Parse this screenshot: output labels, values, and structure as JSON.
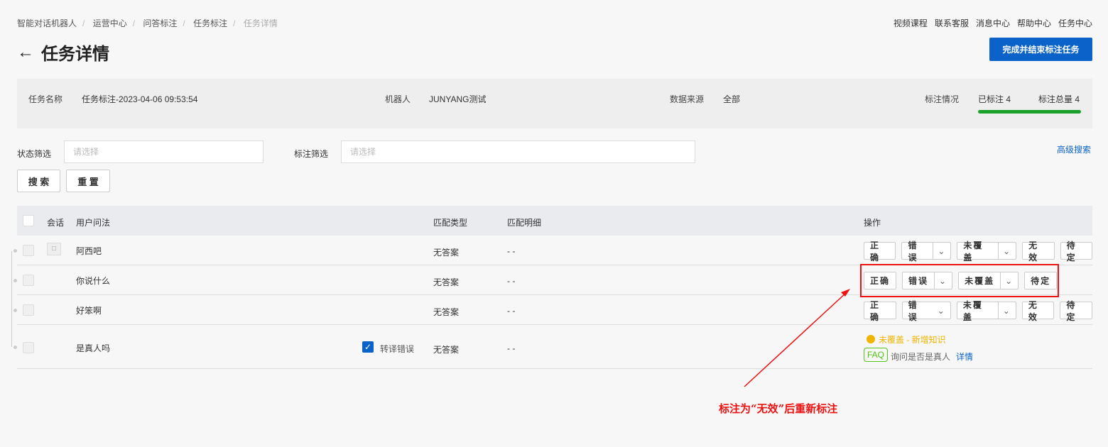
{
  "breadcrumb": [
    "智能对话机器人",
    "运营中心",
    "问答标注",
    "任务标注",
    "任务详情"
  ],
  "top_links": [
    "视频课程",
    "联系客服",
    "消息中心",
    "帮助中心",
    "任务中心"
  ],
  "page_title": "任务详情",
  "finish_button": "完成并结束标注任务",
  "info": {
    "task_name_label": "任务名称",
    "task_name": "任务标注-2023-04-06 09:53:54",
    "robot_label": "机器人",
    "robot": "JUNYANG测试",
    "source_label": "数据来源",
    "source": "全部",
    "status_label": "标注情况",
    "labeled": "已标注 4",
    "total": "标注总量 4",
    "progress": 1.0
  },
  "filters": {
    "status_label": "状态筛选",
    "status_placeholder": "请选择",
    "mark_label": "标注筛选",
    "mark_placeholder": "请选择",
    "advanced": "高级搜索",
    "search": "搜 索",
    "reset": "重 置"
  },
  "table": {
    "headers": {
      "session": "会话",
      "question": "用户问法",
      "match_type": "匹配类型",
      "match_detail": "匹配明细",
      "ops": "操作"
    },
    "rows": [
      {
        "question": "阿西吧",
        "match_type": "无答案",
        "match_detail": "- -"
      },
      {
        "question": "你说什么",
        "match_type": "无答案",
        "match_detail": "- -"
      },
      {
        "question": "好笨啊",
        "match_type": "无答案",
        "match_detail": "- -"
      },
      {
        "question": "是真人吗",
        "match_type": "无答案",
        "match_detail": "- -",
        "transcribe_error": "转译错误",
        "result_status": "未覆盖 - 新增知识",
        "faq_tag": "FAQ",
        "faq_text": "询问是否是真人",
        "detail_link": "详情"
      }
    ],
    "buttons": {
      "correct": "正确",
      "wrong": "错误",
      "uncovered": "未覆盖",
      "invalid": "无效",
      "pending": "待定"
    }
  },
  "annotation": "标注为“无效”后重新标注",
  "colors": {
    "primary": "#0b63c9",
    "progress": "#1aa12a",
    "annotation": "#ee1111",
    "warning": "#f0b400",
    "faq": "#52c41a"
  }
}
